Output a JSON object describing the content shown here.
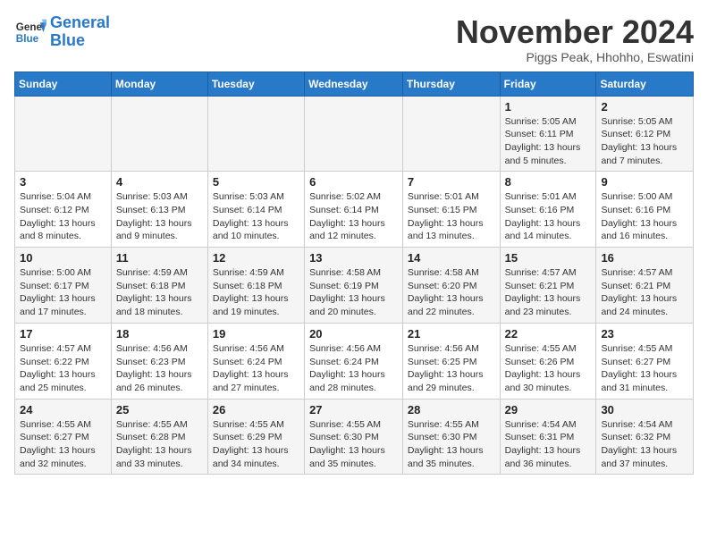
{
  "header": {
    "logo_line1": "General",
    "logo_line2": "Blue",
    "month_title": "November 2024",
    "location": "Piggs Peak, Hhohho, Eswatini"
  },
  "weekdays": [
    "Sunday",
    "Monday",
    "Tuesday",
    "Wednesday",
    "Thursday",
    "Friday",
    "Saturday"
  ],
  "weeks": [
    [
      {
        "day": "",
        "info": ""
      },
      {
        "day": "",
        "info": ""
      },
      {
        "day": "",
        "info": ""
      },
      {
        "day": "",
        "info": ""
      },
      {
        "day": "",
        "info": ""
      },
      {
        "day": "1",
        "info": "Sunrise: 5:05 AM\nSunset: 6:11 PM\nDaylight: 13 hours and 5 minutes."
      },
      {
        "day": "2",
        "info": "Sunrise: 5:05 AM\nSunset: 6:12 PM\nDaylight: 13 hours and 7 minutes."
      }
    ],
    [
      {
        "day": "3",
        "info": "Sunrise: 5:04 AM\nSunset: 6:12 PM\nDaylight: 13 hours and 8 minutes."
      },
      {
        "day": "4",
        "info": "Sunrise: 5:03 AM\nSunset: 6:13 PM\nDaylight: 13 hours and 9 minutes."
      },
      {
        "day": "5",
        "info": "Sunrise: 5:03 AM\nSunset: 6:14 PM\nDaylight: 13 hours and 10 minutes."
      },
      {
        "day": "6",
        "info": "Sunrise: 5:02 AM\nSunset: 6:14 PM\nDaylight: 13 hours and 12 minutes."
      },
      {
        "day": "7",
        "info": "Sunrise: 5:01 AM\nSunset: 6:15 PM\nDaylight: 13 hours and 13 minutes."
      },
      {
        "day": "8",
        "info": "Sunrise: 5:01 AM\nSunset: 6:16 PM\nDaylight: 13 hours and 14 minutes."
      },
      {
        "day": "9",
        "info": "Sunrise: 5:00 AM\nSunset: 6:16 PM\nDaylight: 13 hours and 16 minutes."
      }
    ],
    [
      {
        "day": "10",
        "info": "Sunrise: 5:00 AM\nSunset: 6:17 PM\nDaylight: 13 hours and 17 minutes."
      },
      {
        "day": "11",
        "info": "Sunrise: 4:59 AM\nSunset: 6:18 PM\nDaylight: 13 hours and 18 minutes."
      },
      {
        "day": "12",
        "info": "Sunrise: 4:59 AM\nSunset: 6:18 PM\nDaylight: 13 hours and 19 minutes."
      },
      {
        "day": "13",
        "info": "Sunrise: 4:58 AM\nSunset: 6:19 PM\nDaylight: 13 hours and 20 minutes."
      },
      {
        "day": "14",
        "info": "Sunrise: 4:58 AM\nSunset: 6:20 PM\nDaylight: 13 hours and 22 minutes."
      },
      {
        "day": "15",
        "info": "Sunrise: 4:57 AM\nSunset: 6:21 PM\nDaylight: 13 hours and 23 minutes."
      },
      {
        "day": "16",
        "info": "Sunrise: 4:57 AM\nSunset: 6:21 PM\nDaylight: 13 hours and 24 minutes."
      }
    ],
    [
      {
        "day": "17",
        "info": "Sunrise: 4:57 AM\nSunset: 6:22 PM\nDaylight: 13 hours and 25 minutes."
      },
      {
        "day": "18",
        "info": "Sunrise: 4:56 AM\nSunset: 6:23 PM\nDaylight: 13 hours and 26 minutes."
      },
      {
        "day": "19",
        "info": "Sunrise: 4:56 AM\nSunset: 6:24 PM\nDaylight: 13 hours and 27 minutes."
      },
      {
        "day": "20",
        "info": "Sunrise: 4:56 AM\nSunset: 6:24 PM\nDaylight: 13 hours and 28 minutes."
      },
      {
        "day": "21",
        "info": "Sunrise: 4:56 AM\nSunset: 6:25 PM\nDaylight: 13 hours and 29 minutes."
      },
      {
        "day": "22",
        "info": "Sunrise: 4:55 AM\nSunset: 6:26 PM\nDaylight: 13 hours and 30 minutes."
      },
      {
        "day": "23",
        "info": "Sunrise: 4:55 AM\nSunset: 6:27 PM\nDaylight: 13 hours and 31 minutes."
      }
    ],
    [
      {
        "day": "24",
        "info": "Sunrise: 4:55 AM\nSunset: 6:27 PM\nDaylight: 13 hours and 32 minutes."
      },
      {
        "day": "25",
        "info": "Sunrise: 4:55 AM\nSunset: 6:28 PM\nDaylight: 13 hours and 33 minutes."
      },
      {
        "day": "26",
        "info": "Sunrise: 4:55 AM\nSunset: 6:29 PM\nDaylight: 13 hours and 34 minutes."
      },
      {
        "day": "27",
        "info": "Sunrise: 4:55 AM\nSunset: 6:30 PM\nDaylight: 13 hours and 35 minutes."
      },
      {
        "day": "28",
        "info": "Sunrise: 4:55 AM\nSunset: 6:30 PM\nDaylight: 13 hours and 35 minutes."
      },
      {
        "day": "29",
        "info": "Sunrise: 4:54 AM\nSunset: 6:31 PM\nDaylight: 13 hours and 36 minutes."
      },
      {
        "day": "30",
        "info": "Sunrise: 4:54 AM\nSunset: 6:32 PM\nDaylight: 13 hours and 37 minutes."
      }
    ]
  ]
}
